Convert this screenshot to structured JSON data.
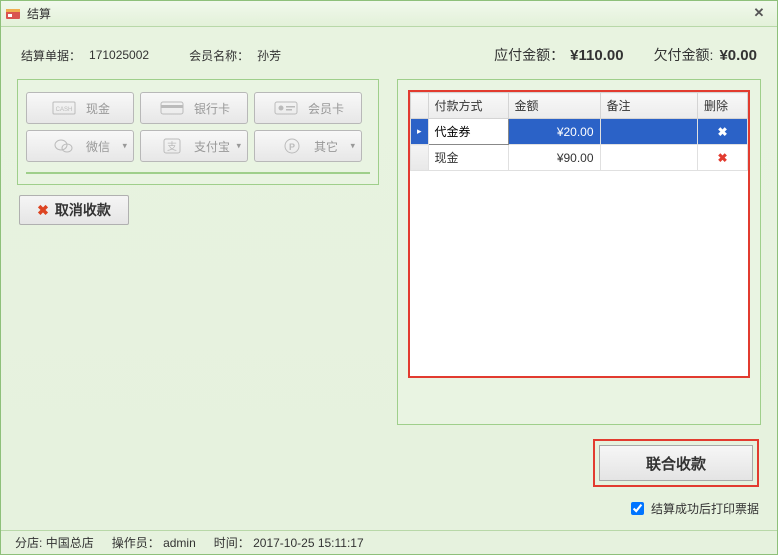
{
  "window": {
    "title": "结算"
  },
  "header": {
    "order_label": "结算单据：",
    "order_value": "171025002",
    "member_label": "会员名称：",
    "member_value": "孙芳",
    "due_label": "应付金额：",
    "due_value": "¥110.00",
    "owed_label": "欠付金额:",
    "owed_value": "¥0.00"
  },
  "payButtons": {
    "cash": "现金",
    "bank": "银行卡",
    "member": "会员卡",
    "wechat": "微信",
    "alipay": "支付宝",
    "other": "其它"
  },
  "cancel_label": "取消收款",
  "grid": {
    "cols": {
      "method": "付款方式",
      "amount": "金额",
      "remark": "备注",
      "delete": "删除"
    },
    "rows": [
      {
        "method": "代金券",
        "amount": "¥20.00",
        "remark": "",
        "selected": true
      },
      {
        "method": "现金",
        "amount": "¥90.00",
        "remark": "",
        "selected": false
      }
    ]
  },
  "combine_label": "联合收款",
  "print_label": "结算成功后打印票据",
  "status": {
    "branch_label": "分店:",
    "branch_value": "中国总店",
    "operator_label": "操作员：",
    "operator_value": "admin",
    "time_label": "时间：",
    "time_value": "2017-10-25 15:11:17"
  }
}
